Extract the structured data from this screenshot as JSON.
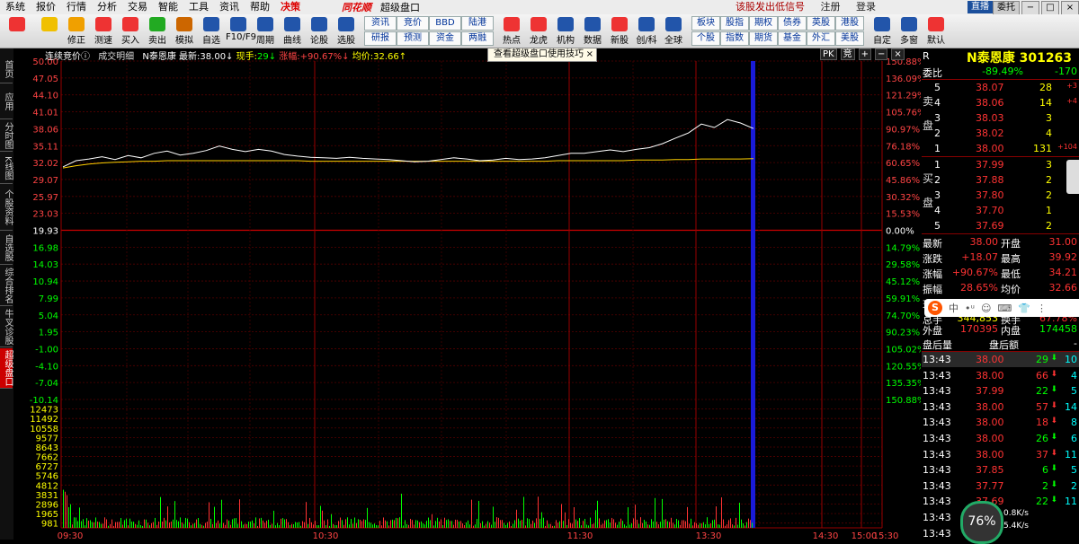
{
  "menu": {
    "items": [
      "系统",
      "报价",
      "行情",
      "分析",
      "交易",
      "智能",
      "工具",
      "资讯",
      "帮助",
      "决策"
    ],
    "logo": "同花顺",
    "app_name": "超级盘口",
    "notices": [
      "该股发出低信号",
      "注册",
      "登录"
    ],
    "window_buttons": [
      "直播",
      "委托"
    ]
  },
  "toolbar": {
    "main": [
      {
        "label": "",
        "icon": "colorful-grid-icon",
        "color": "#e33"
      },
      {
        "label": "",
        "icon": "arrow-left-icon",
        "color": "#f0c000"
      },
      {
        "label": "修正",
        "icon": "up-arrow-icon",
        "color": "#f0a000"
      },
      {
        "label": "测速",
        "icon": "clock-icon",
        "color": "#e33"
      },
      {
        "label": "买入",
        "icon": "buy-icon",
        "color": "#e33"
      },
      {
        "label": "卖出",
        "icon": "sell-icon",
        "color": "#2a2"
      },
      {
        "label": "模拟",
        "icon": "hammer-icon",
        "color": "#c60"
      },
      {
        "label": "自选",
        "icon": "star-list-icon",
        "color": "#25a"
      },
      {
        "label": "F10/F9",
        "icon": "f10-icon",
        "color": "#25a"
      },
      {
        "label": "周期",
        "icon": "cycle-icon",
        "color": "#25a"
      },
      {
        "label": "曲线",
        "icon": "pen-icon",
        "color": "#25a"
      },
      {
        "label": "论股",
        "icon": "forum-icon",
        "color": "#25a"
      },
      {
        "label": "选股",
        "icon": "select-icon",
        "color": "#25a"
      }
    ],
    "grid_top": [
      "资讯",
      "竞价",
      "BBD",
      "陆港"
    ],
    "grid_bottom": [
      "研报",
      "预测",
      "资金",
      "两融"
    ],
    "mid": [
      {
        "label": "热点",
        "icon": "fire-icon",
        "color": "#e33"
      },
      {
        "label": "龙虎",
        "icon": "tiger-icon",
        "color": "#e33"
      },
      {
        "label": "机构",
        "icon": "building-icon",
        "color": "#25a"
      },
      {
        "label": "数据",
        "icon": "pe-icon",
        "color": "#25a"
      },
      {
        "label": "新股",
        "icon": "new-icon",
        "color": "#e33"
      },
      {
        "label": "创/科",
        "icon": "chuang-icon",
        "color": "#25a"
      },
      {
        "label": "全球",
        "icon": "globe-icon",
        "color": "#25a"
      }
    ],
    "grid2_top": [
      "板块",
      "股指",
      "期权",
      "债券",
      "英股",
      "港股"
    ],
    "grid2_bottom": [
      "个股",
      "指数",
      "期货",
      "基金",
      "外汇",
      "美股"
    ],
    "right": [
      {
        "label": "自定",
        "icon": "custom-icon",
        "color": "#25a"
      },
      {
        "label": "多窗",
        "icon": "multi-window-icon",
        "color": "#25a"
      },
      {
        "label": "默认",
        "icon": "home-icon",
        "color": "#e33"
      }
    ]
  },
  "left_tabs": [
    "首页",
    "应用",
    "分时图",
    "K线图",
    "个股资料",
    "自选股",
    "综合排名",
    "牛叉诊股",
    "超级盘口"
  ],
  "chart_info": {
    "prefix": "连续竞价ⓘ",
    "deal": "成交明细",
    "name": "N泰恩康",
    "latest_label": "最新:",
    "latest": "38.00↓",
    "vol_label": "现手:",
    "vol": "29↓",
    "chg_label": "涨幅:",
    "chg": "+90.67%↓",
    "avg_label": "均价:",
    "avg": "32.66↑"
  },
  "tip": {
    "text": "查看超级盘口使用技巧",
    "close": "×"
  },
  "pk": {
    "a": "PK",
    "b": "竞",
    "c": "+",
    "d": "−",
    "e": "×"
  },
  "chart_data": {
    "type": "line",
    "price_axis": [
      "50.00",
      "47.05",
      "44.10",
      "41.01",
      "38.06",
      "35.11",
      "32.02",
      "29.07",
      "25.97",
      "23.03",
      "19.93",
      "16.98",
      "14.03",
      "10.94",
      "7.99",
      "5.04",
      "1.95",
      "-1.00",
      "-4.10",
      "-7.04",
      "-10.14"
    ],
    "pct_axis": [
      "150.88%",
      "136.09%",
      "121.29%",
      "105.76%",
      "90.97%",
      "76.18%",
      "60.65%",
      "45.86%",
      "30.32%",
      "15.53%",
      "0.00%",
      "14.79%",
      "29.58%",
      "45.12%",
      "59.91%",
      "74.70%",
      "90.23%",
      "105.02%",
      "120.55%",
      "135.35%",
      "150.88%"
    ],
    "volume_axis": [
      "12473",
      "11492",
      "10558",
      "9577",
      "8643",
      "7662",
      "6727",
      "5746",
      "4812",
      "3831",
      "2896",
      "1965",
      "981"
    ],
    "time_axis": [
      "09:30",
      "10:30",
      "11:30",
      "13:30",
      "14:30",
      "15:00",
      "15:30"
    ],
    "base_price": 19.93,
    "price": [
      31.2,
      32.3,
      32.6,
      33.0,
      32.5,
      33.2,
      32.8,
      33.6,
      34.0,
      33.3,
      33.6,
      34.1,
      34.9,
      34.3,
      33.9,
      34.3,
      34.0,
      33.4,
      33.1,
      32.9,
      32.8,
      32.7,
      32.9,
      32.7,
      32.6,
      32.5,
      32.3,
      32.1,
      32.2,
      32.5,
      32.8,
      32.6,
      32.3,
      32.4,
      32.7,
      32.5,
      32.6,
      32.8,
      33.2,
      33.6,
      33.6,
      33.9,
      34.2,
      33.9,
      34.3,
      34.6,
      35.3,
      36.3,
      37.2,
      38.8,
      38.2,
      39.6,
      39.0,
      38.0
    ],
    "avg": [
      31.0,
      31.4,
      31.7,
      31.9,
      32.0,
      32.1,
      32.2,
      32.2,
      32.3,
      32.3,
      32.3,
      32.3,
      32.3,
      32.3,
      32.3,
      32.3,
      32.3,
      32.3,
      32.3,
      32.2,
      32.2,
      32.2,
      32.2,
      32.2,
      32.2,
      32.2,
      32.2,
      32.2,
      32.2,
      32.2,
      32.2,
      32.2,
      32.2,
      32.2,
      32.2,
      32.2,
      32.2,
      32.2,
      32.3,
      32.3,
      32.3,
      32.3,
      32.3,
      32.3,
      32.4,
      32.4,
      32.4,
      32.5,
      32.5,
      32.6,
      32.6,
      32.6,
      32.6,
      32.66
    ]
  },
  "panel": {
    "title": "N泰恩康 301263",
    "r_label": "R",
    "weibi": {
      "label": "委比",
      "value": "-89.49%",
      "diff": "-170"
    },
    "sell_label": [
      "卖",
      "盘"
    ],
    "buy_label": [
      "买",
      "盘"
    ],
    "asks": [
      {
        "lvl": "5",
        "price": "38.07",
        "vol": "28",
        "chg": "+3"
      },
      {
        "lvl": "4",
        "price": "38.06",
        "vol": "14",
        "chg": "+4"
      },
      {
        "lvl": "3",
        "price": "38.03",
        "vol": "3",
        "chg": ""
      },
      {
        "lvl": "2",
        "price": "38.02",
        "vol": "4",
        "chg": ""
      },
      {
        "lvl": "1",
        "price": "38.00",
        "vol": "131",
        "chg": "+104"
      }
    ],
    "bids": [
      {
        "lvl": "1",
        "price": "37.99",
        "vol": "3"
      },
      {
        "lvl": "2",
        "price": "37.88",
        "vol": "2"
      },
      {
        "lvl": "3",
        "price": "37.80",
        "vol": "2"
      },
      {
        "lvl": "4",
        "price": "37.70",
        "vol": "1"
      },
      {
        "lvl": "5",
        "price": "37.69",
        "vol": "2"
      }
    ],
    "stats": [
      {
        "l1": "最新",
        "v1": "38.00",
        "l2": "开盘",
        "v2": "31.00"
      },
      {
        "l1": "涨跌",
        "v1": "+18.07",
        "l2": "最高",
        "v2": "39.92"
      },
      {
        "l1": "涨幅",
        "v1": "+90.67%",
        "l2": "最低",
        "v2": "34.21"
      },
      {
        "l1": "振幅",
        "v1": "28.65%",
        "l2": "均价",
        "v2": "32.66"
      },
      {
        "l1": "现手",
        "v1": "29",
        "l2": "量比",
        "v2": "-"
      },
      {
        "l1": "总手",
        "v1": "344,853",
        "l2": "换手",
        "v2": "67.78%"
      }
    ],
    "hidden_row": {
      "l1": "涨停",
      "l2": "跌停"
    },
    "outer": {
      "l1": "外盘",
      "v1": "170395",
      "l2": "内盘",
      "v2": "174458"
    },
    "after": {
      "l1": "盘后量",
      "v1": "-",
      "l2": "盘后额",
      "v2": "-"
    },
    "ticks": [
      {
        "t": "13:43",
        "p": "38.00",
        "v": "29",
        "d": "down",
        "n": "10"
      },
      {
        "t": "13:43",
        "p": "38.00",
        "v": "66",
        "d": "up",
        "n": "4"
      },
      {
        "t": "13:43",
        "p": "37.99",
        "v": "22",
        "d": "down",
        "n": "5"
      },
      {
        "t": "13:43",
        "p": "38.00",
        "v": "57",
        "d": "up",
        "n": "14"
      },
      {
        "t": "13:43",
        "p": "38.00",
        "v": "18",
        "d": "up",
        "n": "8"
      },
      {
        "t": "13:43",
        "p": "38.00",
        "v": "26",
        "d": "down",
        "n": "6"
      },
      {
        "t": "13:43",
        "p": "38.00",
        "v": "37",
        "d": "up",
        "n": "11"
      },
      {
        "t": "13:43",
        "p": "37.85",
        "v": "6",
        "d": "down",
        "n": "5"
      },
      {
        "t": "13:43",
        "p": "37.77",
        "v": "2",
        "d": "down",
        "n": "2"
      },
      {
        "t": "13:43",
        "p": "37.69",
        "v": "22",
        "d": "down",
        "n": "11"
      },
      {
        "t": "13:43",
        "p": "",
        "v": "",
        "d": "",
        "n": ""
      },
      {
        "t": "13:43",
        "p": "",
        "v": "",
        "d": "",
        "n": ""
      }
    ]
  },
  "ime": {
    "logo": "S",
    "items": [
      "中",
      "•ᵘ",
      "☺",
      "⌨",
      "👕",
      "⋮"
    ]
  },
  "gauge": {
    "pct": "76%",
    "up": "0.8K/s",
    "down": "5.4K/s"
  }
}
